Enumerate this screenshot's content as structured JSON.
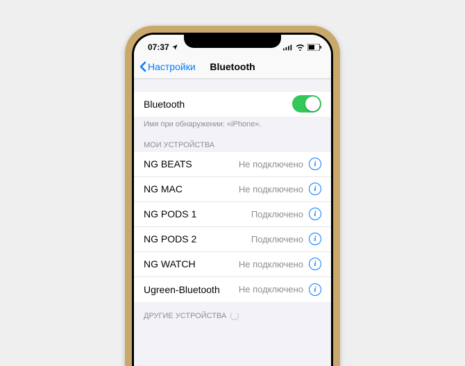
{
  "status": {
    "time": "07:37",
    "locationIcon": "➤"
  },
  "nav": {
    "back": "Настройки",
    "title": "Bluetooth"
  },
  "toggle": {
    "label": "Bluetooth",
    "on": true,
    "note": "Имя при обнаружении: «iPhone»."
  },
  "myDevicesHeader": "МОИ УСТРОЙСТВА",
  "devices": [
    {
      "name": "NG BEATS",
      "status": "Не подключено"
    },
    {
      "name": "NG MAC",
      "status": "Не подключено"
    },
    {
      "name": "NG PODS 1",
      "status": "Подключено"
    },
    {
      "name": "NG PODS 2",
      "status": "Подключено"
    },
    {
      "name": "NG WATCH",
      "status": "Не подключено"
    },
    {
      "name": "Ugreen-Bluetooth",
      "status": "Не подключено"
    }
  ],
  "otherDevicesHeader": "ДРУГИЕ УСТРОЙСТВА"
}
